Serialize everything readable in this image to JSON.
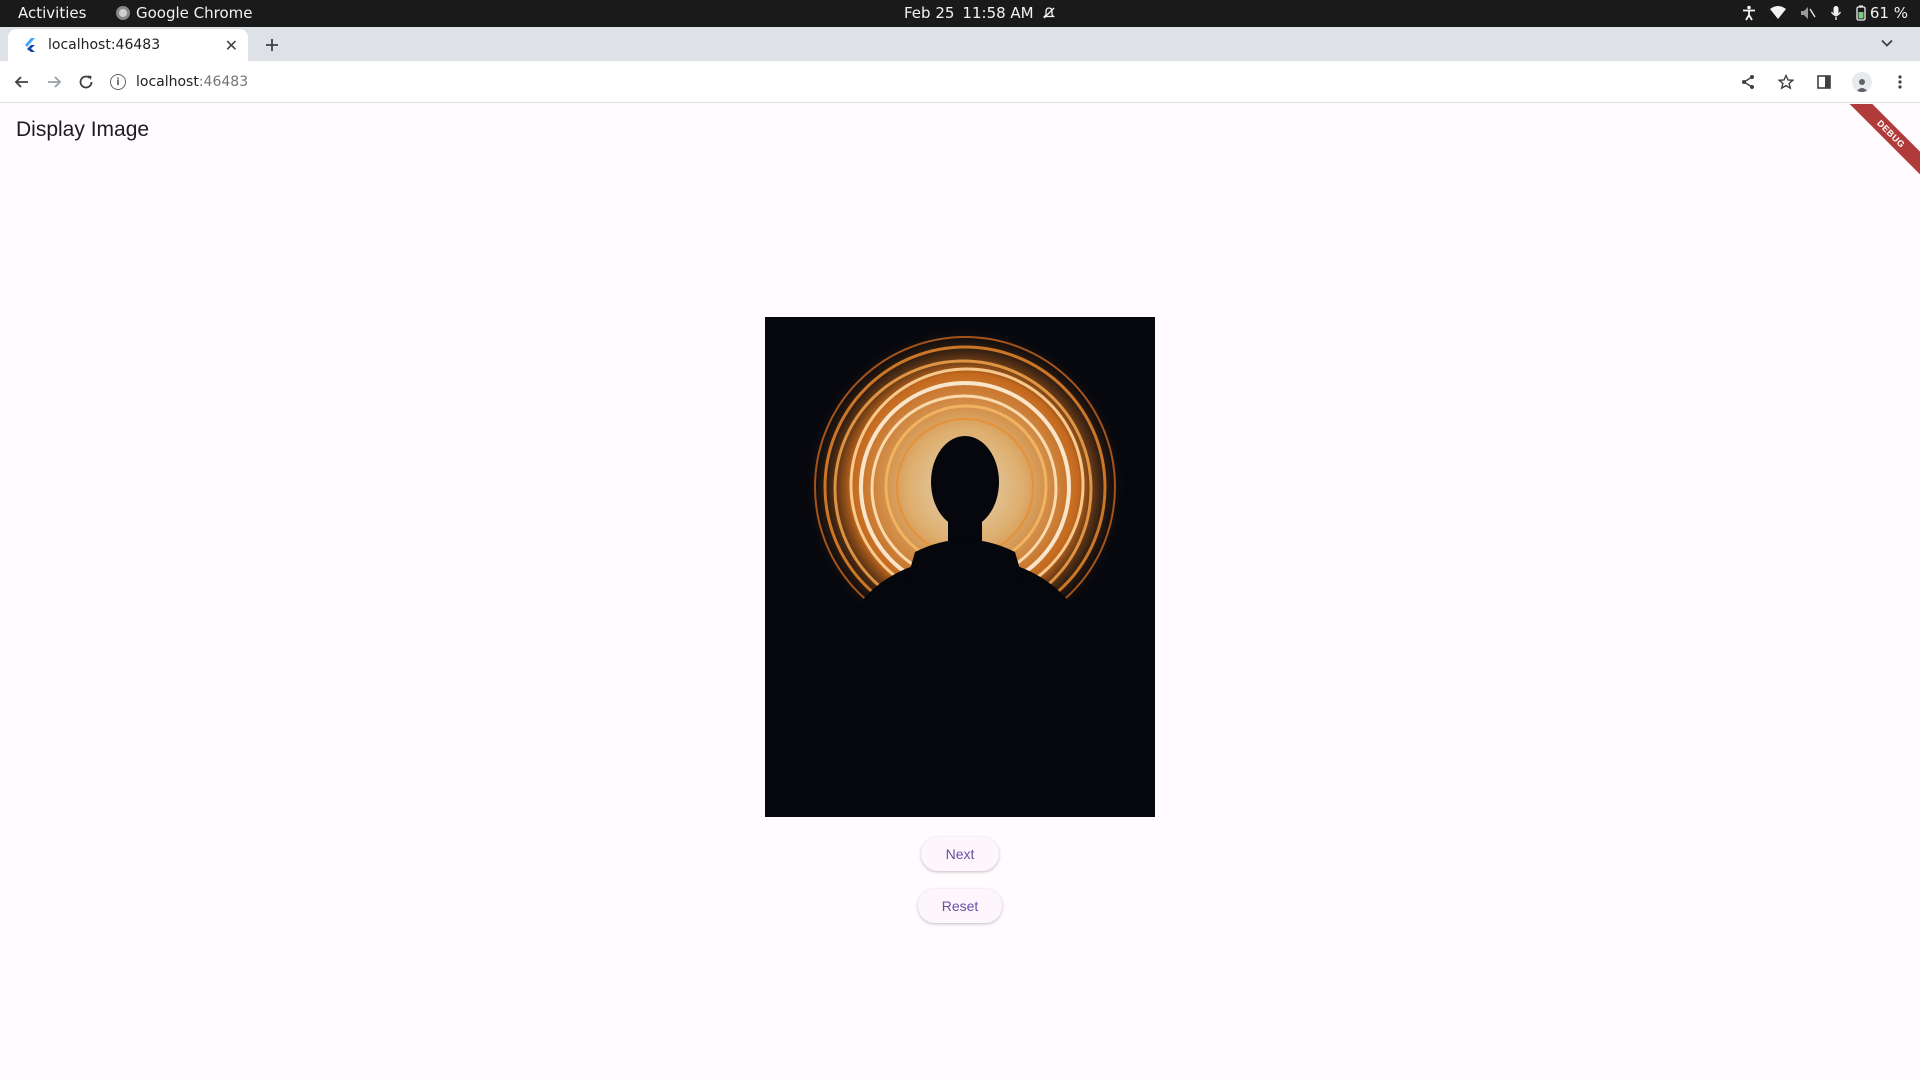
{
  "system_bar": {
    "activities": "Activities",
    "app_name": "Google Chrome",
    "date": "Feb 25",
    "time": "11:58 AM",
    "battery": "61 %"
  },
  "browser": {
    "tab_title": "localhost:46483",
    "url_host": "localhost",
    "url_port": ":46483"
  },
  "app": {
    "title": "Display Image",
    "debug_banner": "DEBUG",
    "image_alt": "Silhouette of a person in front of a spiral of orange light",
    "next_label": "Next",
    "reset_label": "Reset"
  },
  "colors": {
    "accent": "#6750a4",
    "background": "#fffbfe",
    "debug_banner": "#b13b3b"
  }
}
